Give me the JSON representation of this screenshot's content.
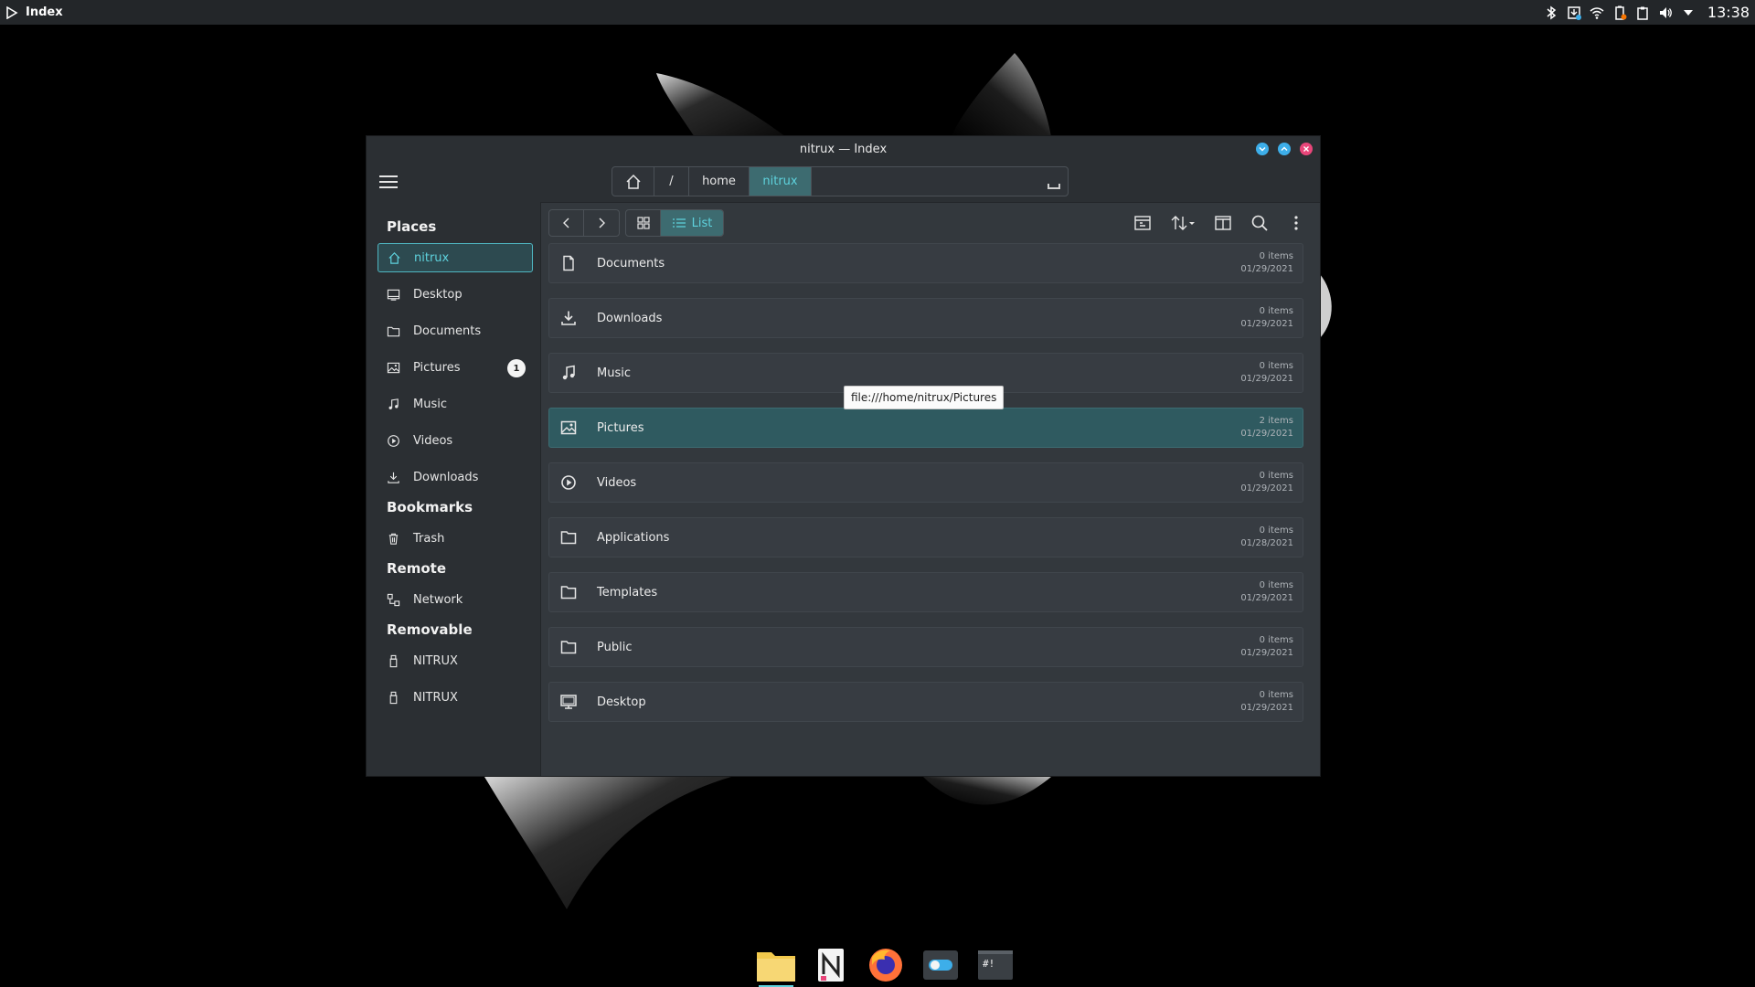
{
  "panel": {
    "app_name": "Index",
    "clock": "13:38"
  },
  "window": {
    "title": "nitrux — Index"
  },
  "pathbar": {
    "root": "/",
    "home": "home",
    "current": "nitrux"
  },
  "sidebar": {
    "places_title": "Places",
    "places": [
      {
        "label": "nitrux",
        "icon": "home-icon"
      },
      {
        "label": "Desktop",
        "icon": "desktop-icon"
      },
      {
        "label": "Documents",
        "icon": "folder-icon"
      },
      {
        "label": "Pictures",
        "icon": "pictures-icon",
        "badge": "1"
      },
      {
        "label": "Music",
        "icon": "music-icon"
      },
      {
        "label": "Videos",
        "icon": "videos-icon"
      },
      {
        "label": "Downloads",
        "icon": "download-icon"
      }
    ],
    "bookmarks_title": "Bookmarks",
    "bookmarks": [
      {
        "label": "Trash",
        "icon": "trash-icon"
      }
    ],
    "remote_title": "Remote",
    "remote": [
      {
        "label": "Network",
        "icon": "network-icon"
      }
    ],
    "removable_title": "Removable",
    "removable": [
      {
        "label": "NITRUX",
        "icon": "usb-icon"
      },
      {
        "label": "NITRUX",
        "icon": "usb-icon"
      }
    ]
  },
  "toolbar": {
    "list_label": "List"
  },
  "files": [
    {
      "name": "Documents",
      "items": "0 items",
      "date": "01/29/2021",
      "icon": "document-icon"
    },
    {
      "name": "Downloads",
      "items": "0 items",
      "date": "01/29/2021",
      "icon": "download-icon"
    },
    {
      "name": "Music",
      "items": "0 items",
      "date": "01/29/2021",
      "icon": "music-icon"
    },
    {
      "name": "Pictures",
      "items": "2 items",
      "date": "01/29/2021",
      "icon": "pictures-icon",
      "selected": true
    },
    {
      "name": "Videos",
      "items": "0 items",
      "date": "01/29/2021",
      "icon": "videos-icon"
    },
    {
      "name": "Applications",
      "items": "0 items",
      "date": "01/28/2021",
      "icon": "folder-icon"
    },
    {
      "name": "Templates",
      "items": "0 items",
      "date": "01/29/2021",
      "icon": "folder-icon"
    },
    {
      "name": "Public",
      "items": "0 items",
      "date": "01/29/2021",
      "icon": "folder-icon"
    },
    {
      "name": "Desktop",
      "items": "0 items",
      "date": "01/29/2021",
      "icon": "desktop-icon"
    }
  ],
  "tooltip": "file:///home/nitrux/Pictures",
  "colors": {
    "accent": "#5ed2dd",
    "selected_row": "#2f5a60",
    "window_bg": "#2b2f33",
    "main_bg": "#33383d"
  },
  "dock": [
    {
      "name": "files-app",
      "icon": "folder-icon"
    },
    {
      "name": "nx-software-center",
      "icon": "n-icon"
    },
    {
      "name": "firefox",
      "icon": "firefox-icon"
    },
    {
      "name": "system-settings",
      "icon": "toggle-icon"
    },
    {
      "name": "terminal",
      "icon": "terminal-icon"
    }
  ]
}
